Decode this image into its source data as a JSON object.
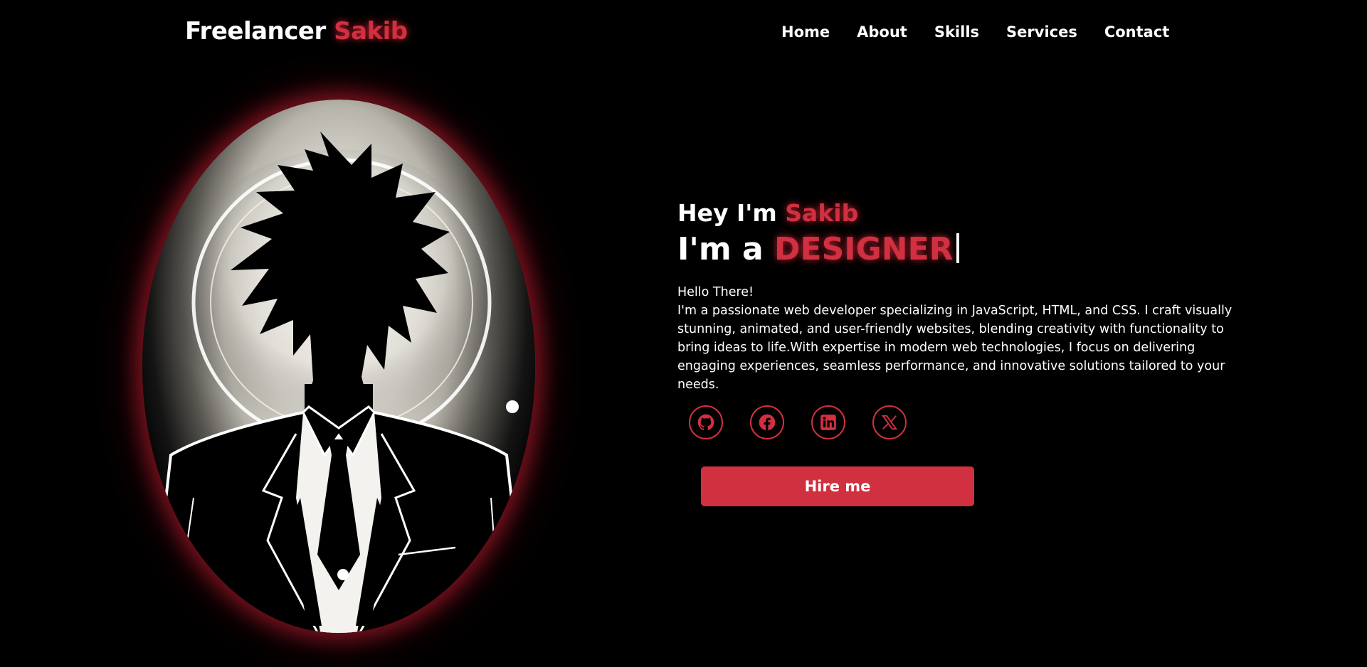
{
  "header": {
    "logo_main": "Freelancer",
    "logo_accent": "Sakib",
    "nav": [
      "Home",
      "About",
      "Skills",
      "Services",
      "Contact"
    ]
  },
  "hero": {
    "greeting_prefix": "Hey I'm",
    "greeting_name": "Sakib",
    "role_prefix": "I'm a",
    "role_word": "DESIGNER",
    "intro_heading": "Hello There!",
    "intro_body": "I'm a passionate web developer specializing in JavaScript, HTML, and CSS. I craft visually stunning, animated, and user-friendly websites, blending creativity with functionality to bring ideas to life.With expertise in modern web technologies, I focus on delivering engaging experiences, seamless performance, and innovative solutions tailored to your needs.",
    "hire_label": "Hire me"
  },
  "socials": [
    {
      "icon": "github-icon"
    },
    {
      "icon": "facebook-icon"
    },
    {
      "icon": "linkedin-icon"
    },
    {
      "icon": "x-icon"
    }
  ],
  "colors": {
    "background": "#000000",
    "accent": "#d0303f",
    "text": "#ffffff"
  }
}
